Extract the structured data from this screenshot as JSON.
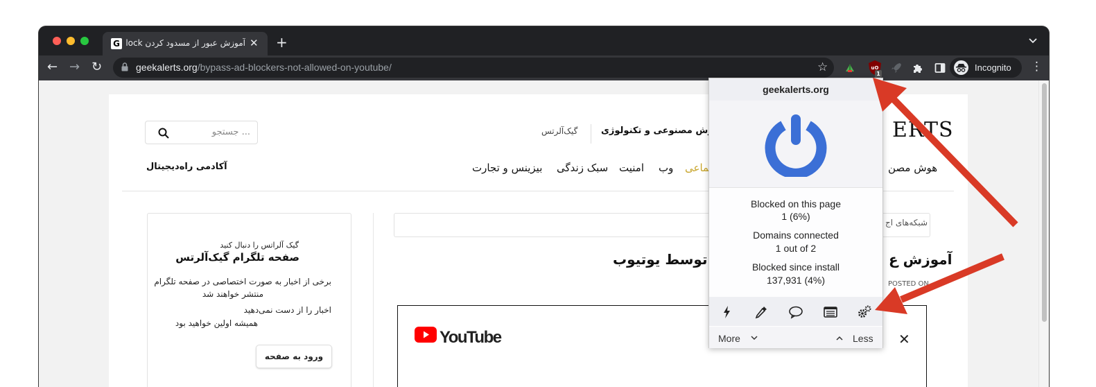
{
  "browser": {
    "tab": {
      "favicon_letter": "G",
      "title": "آموزش عبور از مسدود کردن adblock",
      "close_glyph": "✕"
    },
    "new_tab_glyph": "+",
    "tab_menu_glyph": "⌄",
    "nav": {
      "back": "←",
      "forward": "→",
      "reload": "↻"
    },
    "url_host": "geekalerts.org",
    "url_path": "/bypass-ad-blockers-not-allowed-on-youtube/",
    "bookmark_glyph": "☆",
    "extensions": [
      "feedly-icon",
      "ublock-origin-icon",
      "rocket-icon",
      "puzzle-icon"
    ],
    "ublock_badge": "1",
    "profile_label": "Incognito",
    "menu_glyph": "⋮"
  },
  "site": {
    "search_placeholder": "جستجو ...",
    "tagline": "ت هوش مصنوعی و تکنولوژی",
    "sitename_small": "گیک‌آلرتس",
    "logo_fragment": "ERTS",
    "nav": [
      "هوش مصن",
      "تماعی",
      "وب",
      "امنیت",
      "سبک زندگی",
      "بیزینس و تجارت"
    ],
    "academy": "آکادمی راه‌دیجیتال",
    "card": {
      "subtitle": "گیک آلراتس را دنبال کنید",
      "title": "صفحه تلگرام گیک‌آلرتس",
      "line1": "برخی از اخبار به صورت اختصاصی در صفحه تلگرام",
      "line2": "منتشر خواهند شد",
      "line3": "اخبار را از دست نمی‌دهید",
      "line4": "همیشه اولین خواهید بود",
      "button": "ورود به صفحه"
    },
    "breadcrumb": "شبکه‌های اج",
    "article_title_right": "آموزش ع",
    "article_title_left": "ها توسط یوتیوب",
    "posted": "POSTED ON",
    "video": {
      "brand": "YouTube",
      "close_glyph": "✕"
    }
  },
  "ublock_popup": {
    "hostname": "geekalerts.org",
    "blocked_label": "Blocked on this page",
    "blocked_value": "1 (6%)",
    "domains_label": "Domains connected",
    "domains_value": "1 out of 2",
    "since_label": "Blocked since install",
    "since_value": "137,931 (4%)",
    "tools": [
      "zap-icon",
      "eyedropper-icon",
      "comment-icon",
      "logger-icon",
      "settings-gears-icon"
    ],
    "more_label": "More",
    "less_label": "Less",
    "accent_color": "#3b6fd6"
  },
  "annotations": {
    "arrow_color": "#d93a26"
  }
}
